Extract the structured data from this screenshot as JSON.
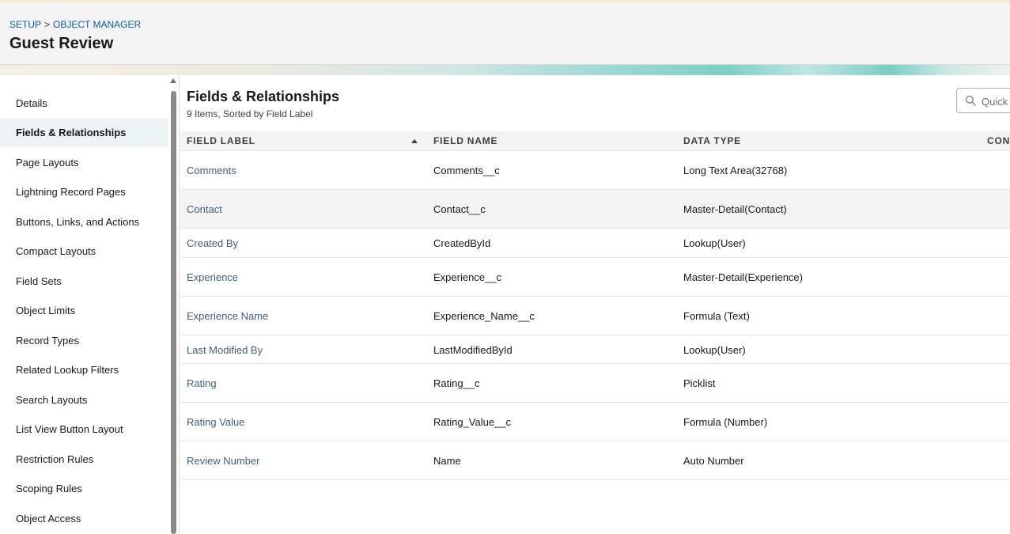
{
  "breadcrumb": {
    "setup": "SETUP",
    "separator": ">",
    "object_manager": "OBJECT MANAGER"
  },
  "page_title": "Guest Review",
  "sidebar": {
    "items": [
      {
        "label": "Details"
      },
      {
        "label": "Fields & Relationships",
        "active": true
      },
      {
        "label": "Page Layouts"
      },
      {
        "label": "Lightning Record Pages"
      },
      {
        "label": "Buttons, Links, and Actions"
      },
      {
        "label": "Compact Layouts"
      },
      {
        "label": "Field Sets"
      },
      {
        "label": "Object Limits"
      },
      {
        "label": "Record Types"
      },
      {
        "label": "Related Lookup Filters"
      },
      {
        "label": "Search Layouts"
      },
      {
        "label": "List View Button Layout"
      },
      {
        "label": "Restriction Rules"
      },
      {
        "label": "Scoping Rules"
      },
      {
        "label": "Object Access"
      }
    ]
  },
  "main": {
    "title": "Fields & Relationships",
    "subtitle": "9 Items, Sorted by Field Label",
    "quick_find_placeholder": "Quick Find",
    "columns": [
      "FIELD LABEL",
      "FIELD NAME",
      "DATA TYPE",
      "CON"
    ],
    "rows": [
      {
        "label": "Comments",
        "api": "Comments__c",
        "type": "Long Text Area(32768)"
      },
      {
        "label": "Contact",
        "api": "Contact__c",
        "type": "Master-Detail(Contact)"
      },
      {
        "label": "Created By",
        "api": "CreatedById",
        "type": "Lookup(User)"
      },
      {
        "label": "Experience",
        "api": "Experience__c",
        "type": "Master-Detail(Experience)"
      },
      {
        "label": "Experience Name",
        "api": "Experience_Name__c",
        "type": "Formula (Text)"
      },
      {
        "label": "Last Modified By",
        "api": "LastModifiedById",
        "type": "Lookup(User)"
      },
      {
        "label": "Rating",
        "api": "Rating__c",
        "type": "Picklist"
      },
      {
        "label": "Rating Value",
        "api": "Rating_Value__c",
        "type": "Formula (Number)"
      },
      {
        "label": "Review Number",
        "api": "Name",
        "type": "Auto Number"
      }
    ]
  }
}
